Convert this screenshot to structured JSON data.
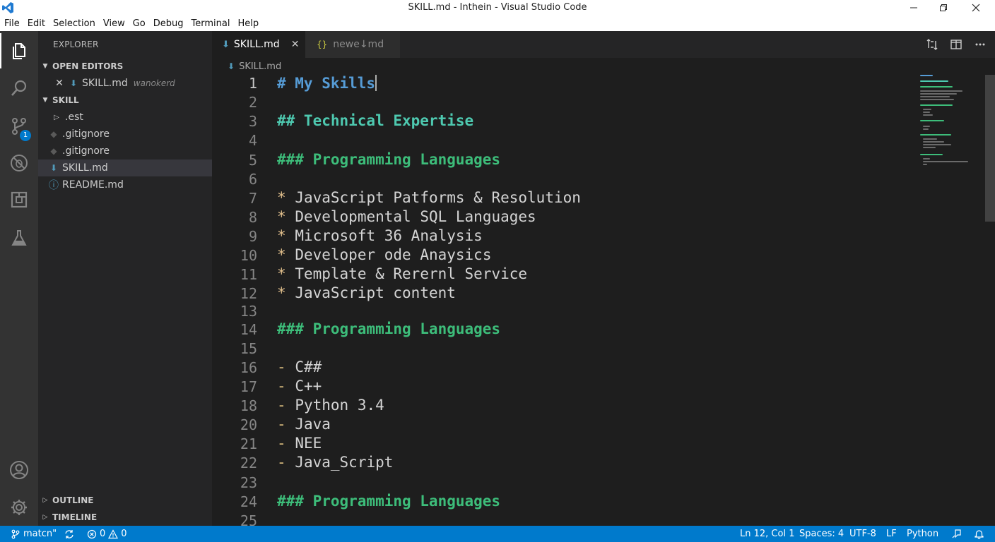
{
  "window": {
    "title": "SKILL.md - Inthein - Visual Studio Code"
  },
  "menu": [
    "File",
    "Edit",
    "Selection",
    "View",
    "Go",
    "Debug",
    "Terminal",
    "Help"
  ],
  "sidebar": {
    "title": "EXPLORER",
    "open_editors": {
      "header": "OPEN EDITORS",
      "items": [
        {
          "name": "SKILL.md",
          "hint": "wanokerd"
        }
      ]
    },
    "folder": {
      "header": "SKILL",
      "items": [
        {
          "name": ".est",
          "icon": "chevron-right-icon"
        },
        {
          "name": ".gitignore",
          "icon": "git-diamond-icon"
        },
        {
          "name": ".gitignore",
          "icon": "git-diamond-icon"
        },
        {
          "name": "SKILL.md",
          "icon": "markdown-down-arrow-icon"
        },
        {
          "name": "README.md",
          "icon": "info-circle-icon"
        }
      ]
    },
    "outline": "OUTLINE",
    "timeline": "TIMELINE"
  },
  "tabs": [
    {
      "label": "SKILL.md",
      "active": true
    },
    {
      "label": "newe↓md",
      "active": false
    }
  ],
  "breadcrumb": "SKILL.md",
  "source_control_badge": "1",
  "editor": {
    "lines": [
      {
        "n": "1",
        "text": "# My Skills",
        "kind": "h1"
      },
      {
        "n": "2",
        "text": "",
        "kind": "blank"
      },
      {
        "n": "3",
        "text": "## Technical Expertise",
        "kind": "h2"
      },
      {
        "n": "4",
        "text": "",
        "kind": "blank"
      },
      {
        "n": "5",
        "text": "### Programming Languages",
        "kind": "h3"
      },
      {
        "n": "6",
        "text": "",
        "kind": "blank"
      },
      {
        "n": "7",
        "marker": "*",
        "text": "JavaScript Patforms & Resolution",
        "kind": "bullet"
      },
      {
        "n": "8",
        "marker": "*",
        "text": "Developmental SQL Languages",
        "kind": "bullet"
      },
      {
        "n": "9",
        "marker": "*",
        "text": "Microsoft 36 Analysis",
        "kind": "bullet"
      },
      {
        "n": "10",
        "marker": "*",
        "text": "Developer ode Anaysics",
        "kind": "bullet"
      },
      {
        "n": "11",
        "marker": "*",
        "text": "Template & Rerernl Service",
        "kind": "bullet"
      },
      {
        "n": "12",
        "marker": "*",
        "text": "JavaScript content",
        "kind": "bullet"
      },
      {
        "n": "13",
        "text": "",
        "kind": "blank"
      },
      {
        "n": "14",
        "text": "### Programming Languages",
        "kind": "h3"
      },
      {
        "n": "15",
        "text": "",
        "kind": "blank"
      },
      {
        "n": "16",
        "marker": "-",
        "text": "C##",
        "kind": "dash"
      },
      {
        "n": "17",
        "marker": "-",
        "text": "C++",
        "kind": "dash"
      },
      {
        "n": "18",
        "marker": "-",
        "text": "Python 3.4",
        "kind": "dash"
      },
      {
        "n": "20",
        "marker": "-",
        "text": "Java",
        "kind": "dash"
      },
      {
        "n": "21",
        "marker": "-",
        "text": "NEE",
        "kind": "dash"
      },
      {
        "n": "22",
        "marker": "-",
        "text": "Java_Script",
        "kind": "dash"
      },
      {
        "n": "23",
        "text": "",
        "kind": "blank"
      },
      {
        "n": "24",
        "text": "### Programming Languages",
        "kind": "h3"
      },
      {
        "n": "25",
        "text": "",
        "kind": "blank"
      }
    ]
  },
  "status": {
    "branch": "matcn\"",
    "errors": "0",
    "warnings": "0",
    "position": "Ln 12, Col 1",
    "spaces": "Spaces: 4",
    "encoding": "UTF-8",
    "eol": "LF",
    "language": "Python"
  },
  "colors": {
    "accent": "#007acc",
    "heading1": "#569cd6",
    "heading3": "#3dbd7a"
  }
}
